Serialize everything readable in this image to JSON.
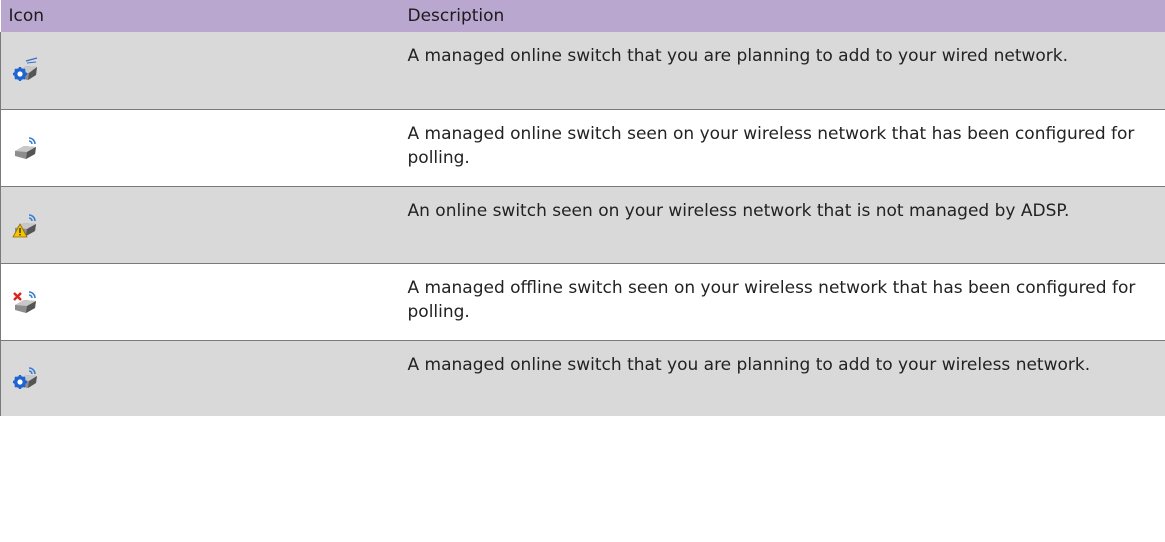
{
  "table": {
    "headers": {
      "icon": "Icon",
      "description": "Description"
    },
    "rows": [
      {
        "icon": "wired-planned-switch-icon",
        "description": "A managed online switch that you are planning to add to your wired network."
      },
      {
        "icon": "polled-switch-icon",
        "description": "A managed online switch seen on your wireless network that has been configured for polling."
      },
      {
        "icon": "unmanaged-switch-warning-icon",
        "description": "An online switch seen on your wireless network that is not managed by ADSP."
      },
      {
        "icon": "offline-switch-icon",
        "description": "A managed offline switch seen on your wireless network that has been configured for polling."
      },
      {
        "icon": "wireless-planned-switch-icon",
        "description": "A managed online switch that you are planning to add to your wireless network."
      }
    ]
  },
  "colors": {
    "header_bg": "#b9a7cf",
    "alt_row_bg": "#d9d9d9",
    "gear_blue": "#1e64d2",
    "warning_yellow": "#f5c400",
    "error_red": "#d9261c"
  }
}
